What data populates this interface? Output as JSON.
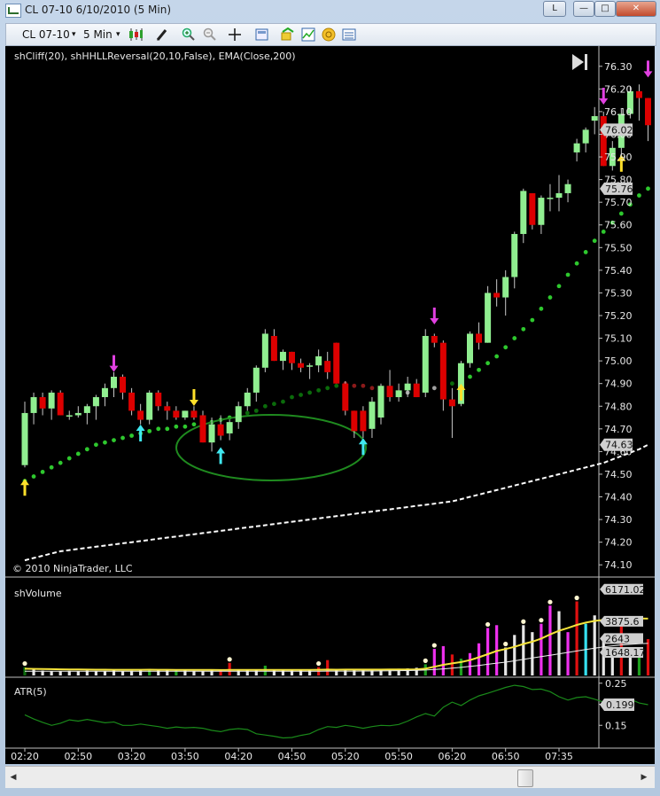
{
  "window": {
    "title": "CL 07-10  6/10/2010 (5 Min)",
    "btn_l": "L",
    "btn_min": "—",
    "btn_max": "□",
    "btn_close": "✕"
  },
  "toolbar": {
    "instrument": "CL 07-10",
    "interval": "5 Min",
    "dropdown_glyph": "▾",
    "icons": [
      "candlestick-style-icon",
      "pencil-draw-icon",
      "zoom-in-icon",
      "zoom-out-icon",
      "crosshair-icon",
      "properties-icon",
      "strategy-icon",
      "indicator-icon",
      "coin-icon",
      "data-box-icon"
    ]
  },
  "colors": {
    "up": "#90ee90",
    "down": "#dc0000",
    "magenta": "#e040e0",
    "cyan": "#40e8f0",
    "yellow": "#ffe02a",
    "green_dot": "#2ec82e",
    "darkgreen_dot": "#0b6b0b",
    "red_dot": "#8b1a1a",
    "gray_dot": "#a0a0a0",
    "ellipse": "#1f8a1f"
  },
  "chart_data": [
    {
      "type": "line",
      "panel": "price",
      "title": "shCliff(20), shHHLLReversal(20,10,False), EMA(Close,200)",
      "copyright": "© 2010 NinjaTrader, LLC",
      "ylim": [
        74.05,
        76.35
      ],
      "yticks": [
        "76.30",
        "76.20",
        "76.10",
        "76.00",
        "75.90",
        "75.80",
        "75.70",
        "75.60",
        "75.50",
        "75.40",
        "75.30",
        "75.20",
        "75.10",
        "75.00",
        "74.90",
        "74.80",
        "74.70",
        "74.60",
        "74.50",
        "74.40",
        "74.30",
        "74.20",
        "74.10"
      ],
      "xticks": [
        "02:20",
        "02:50",
        "03:20",
        "03:50",
        "04:20",
        "04:50",
        "05:20",
        "05:50",
        "06:20",
        "06:50",
        "07:35"
      ],
      "xtick_index": [
        0,
        6,
        12,
        18,
        24,
        30,
        36,
        42,
        48,
        54,
        60
      ],
      "candles": [
        [
          74.54,
          74.82,
          74.53,
          74.77
        ],
        [
          74.77,
          74.86,
          74.72,
          74.84
        ],
        [
          74.84,
          74.86,
          74.76,
          74.79
        ],
        [
          74.79,
          74.87,
          74.74,
          74.86
        ],
        [
          74.86,
          74.87,
          74.76,
          74.76
        ],
        [
          74.76,
          74.78,
          74.74,
          74.76
        ],
        [
          74.76,
          74.8,
          74.75,
          74.77
        ],
        [
          74.77,
          74.81,
          74.72,
          74.8
        ],
        [
          74.8,
          74.85,
          74.74,
          74.84
        ],
        [
          74.84,
          74.9,
          74.8,
          74.88
        ],
        [
          74.88,
          74.95,
          74.84,
          74.93
        ],
        [
          74.93,
          74.94,
          74.83,
          74.86
        ],
        [
          74.86,
          74.88,
          74.76,
          74.78
        ],
        [
          74.78,
          74.81,
          74.72,
          74.74
        ],
        [
          74.74,
          74.87,
          74.72,
          74.86
        ],
        [
          74.86,
          74.87,
          74.78,
          74.8
        ],
        [
          74.8,
          74.82,
          74.74,
          74.78
        ],
        [
          74.78,
          74.8,
          74.74,
          74.75
        ],
        [
          74.75,
          74.78,
          74.74,
          74.78
        ],
        [
          74.78,
          74.8,
          74.74,
          74.75
        ],
        [
          74.76,
          74.78,
          74.64,
          74.64
        ],
        [
          74.64,
          74.75,
          74.6,
          74.72
        ],
        [
          74.72,
          74.76,
          74.65,
          74.67
        ],
        [
          74.68,
          74.74,
          74.65,
          74.73
        ],
        [
          74.73,
          74.82,
          74.7,
          74.8
        ],
        [
          74.8,
          74.88,
          74.78,
          74.86
        ],
        [
          74.86,
          74.98,
          74.82,
          74.97
        ],
        [
          74.97,
          75.14,
          74.95,
          75.12
        ],
        [
          75.11,
          75.14,
          75.0,
          75.0
        ],
        [
          75.0,
          75.05,
          74.96,
          75.04
        ],
        [
          75.04,
          75.04,
          74.96,
          74.99
        ],
        [
          74.99,
          75.01,
          74.95,
          74.97
        ],
        [
          74.98,
          74.99,
          74.92,
          74.98
        ],
        [
          74.98,
          75.05,
          74.95,
          75.02
        ],
        [
          75.0,
          75.04,
          74.92,
          74.95
        ],
        [
          75.08,
          75.08,
          74.9,
          74.9
        ],
        [
          74.9,
          74.91,
          74.76,
          74.78
        ],
        [
          74.78,
          74.78,
          74.66,
          74.69
        ],
        [
          74.78,
          74.8,
          74.66,
          74.69
        ],
        [
          74.7,
          74.84,
          74.66,
          74.82
        ],
        [
          74.75,
          74.9,
          74.72,
          74.89
        ],
        [
          74.89,
          74.96,
          74.82,
          74.84
        ],
        [
          74.84,
          74.9,
          74.82,
          74.87
        ],
        [
          74.87,
          74.93,
          74.84,
          74.9
        ],
        [
          74.9,
          74.92,
          74.84,
          74.84
        ],
        [
          74.86,
          75.14,
          74.84,
          75.11
        ],
        [
          75.11,
          75.12,
          75.06,
          75.08
        ],
        [
          75.08,
          75.09,
          74.78,
          74.83
        ],
        [
          74.83,
          74.88,
          74.66,
          74.8
        ],
        [
          74.81,
          75.0,
          74.8,
          74.99
        ],
        [
          74.99,
          75.13,
          74.97,
          75.12
        ],
        [
          75.12,
          75.17,
          75.05,
          75.08
        ],
        [
          75.08,
          75.33,
          75.08,
          75.3
        ],
        [
          75.3,
          75.36,
          75.24,
          75.28
        ],
        [
          75.28,
          75.4,
          75.2,
          75.37
        ],
        [
          75.37,
          75.57,
          75.32,
          75.56
        ],
        [
          75.56,
          75.76,
          75.52,
          75.75
        ],
        [
          75.74,
          75.74,
          75.58,
          75.6
        ],
        [
          75.6,
          75.73,
          75.56,
          75.72
        ],
        [
          75.72,
          75.78,
          75.66,
          75.72
        ],
        [
          75.72,
          75.82,
          75.66,
          75.74
        ],
        [
          75.74,
          75.8,
          75.7,
          75.78
        ],
        [
          75.92,
          75.98,
          75.88,
          75.96
        ],
        [
          75.96,
          76.03,
          75.92,
          76.02
        ],
        [
          76.06,
          76.12,
          76.0,
          76.08
        ],
        [
          76.08,
          76.1,
          75.86,
          75.86
        ],
        [
          75.86,
          75.97,
          75.84,
          75.94
        ],
        [
          75.94,
          76.11,
          75.89,
          76.09
        ],
        [
          76.09,
          76.21,
          76.07,
          76.19
        ],
        [
          76.19,
          76.22,
          76.06,
          76.16
        ],
        [
          76.16,
          76.16,
          75.97,
          76.04
        ]
      ],
      "cliff": [
        74.47,
        74.49,
        74.51,
        74.53,
        74.55,
        74.57,
        74.59,
        74.61,
        74.63,
        74.64,
        74.65,
        74.66,
        74.67,
        74.68,
        74.69,
        74.7,
        74.7,
        74.71,
        74.71,
        74.72,
        74.73,
        74.73,
        74.74,
        74.75,
        74.76,
        74.77,
        74.78,
        74.8,
        74.81,
        74.82,
        74.84,
        74.85,
        74.86,
        74.87,
        74.88,
        74.89,
        74.9,
        74.89,
        74.89,
        74.88,
        74.88,
        74.87,
        74.86,
        74.86,
        74.86,
        74.87,
        74.88,
        74.89,
        74.9,
        74.91,
        74.93,
        74.96,
        74.99,
        75.02,
        75.06,
        75.1,
        75.14,
        75.18,
        75.23,
        75.28,
        75.33,
        75.38,
        75.43,
        75.48,
        75.53,
        75.57,
        75.61,
        75.65,
        75.69,
        75.73,
        75.76
      ],
      "cliff_color": [
        "g",
        "g",
        "g",
        "g",
        "g",
        "g",
        "g",
        "g",
        "g",
        "g",
        "g",
        "g",
        "g",
        "g",
        "g",
        "g",
        "g",
        "g",
        "g",
        "g",
        "g",
        "g",
        "g",
        "g",
        "dg",
        "dg",
        "dg",
        "dg",
        "dg",
        "dg",
        "dg",
        "dg",
        "dg",
        "dg",
        "dg",
        "dg",
        "r",
        "r",
        "r",
        "r",
        "gr",
        "gr",
        "gr",
        "gr",
        "gr",
        "gr",
        "gr",
        "dg",
        "dg",
        "dg",
        "g",
        "g",
        "g",
        "g",
        "g",
        "g",
        "g",
        "g",
        "g",
        "g",
        "g",
        "g",
        "g",
        "g",
        "g",
        "g",
        "g",
        "g",
        "g",
        "g",
        "g"
      ],
      "ema": [
        74.12,
        74.13,
        74.14,
        74.15,
        74.16,
        74.165,
        74.17,
        74.175,
        74.18,
        74.185,
        74.19,
        74.195,
        74.2,
        74.205,
        74.21,
        74.215,
        74.22,
        74.225,
        74.23,
        74.235,
        74.24,
        74.245,
        74.25,
        74.255,
        74.26,
        74.265,
        74.27,
        74.275,
        74.28,
        74.285,
        74.29,
        74.295,
        74.3,
        74.305,
        74.31,
        74.315,
        74.32,
        74.325,
        74.33,
        74.335,
        74.34,
        74.345,
        74.35,
        74.355,
        74.36,
        74.365,
        74.37,
        74.375,
        74.38,
        74.39,
        74.4,
        74.41,
        74.42,
        74.43,
        74.44,
        74.45,
        74.46,
        74.47,
        74.48,
        74.49,
        74.5,
        74.51,
        74.52,
        74.53,
        74.54,
        74.55,
        74.565,
        74.58,
        74.595,
        74.61,
        74.63
      ],
      "arrows": [
        {
          "i": 0,
          "dir": "up",
          "color": "yellow",
          "y": 74.44
        },
        {
          "i": 10,
          "dir": "down",
          "color": "magenta",
          "y": 74.99
        },
        {
          "i": 13,
          "dir": "up",
          "color": "cyan",
          "y": 74.68
        },
        {
          "i": 19,
          "dir": "down",
          "color": "yellow",
          "y": 74.84
        },
        {
          "i": 22,
          "dir": "up",
          "color": "cyan",
          "y": 74.58
        },
        {
          "i": 38,
          "dir": "up",
          "color": "cyan",
          "y": 74.62
        },
        {
          "i": 46,
          "dir": "down",
          "color": "magenta",
          "y": 75.2
        },
        {
          "i": 49,
          "dir": "up",
          "color": "yellow",
          "y": 74.86
        },
        {
          "i": 65,
          "dir": "down",
          "color": "magenta",
          "y": 76.17
        },
        {
          "i": 67,
          "dir": "up",
          "color": "yellow",
          "y": 75.87
        },
        {
          "i": 70,
          "dir": "down",
          "color": "magenta",
          "y": 76.29
        }
      ],
      "last_labels": [
        "76.02",
        "75.76",
        "74.63"
      ]
    },
    {
      "type": "bar",
      "panel": "volume",
      "title": "shVolume",
      "ylim": [
        0,
        6600
      ],
      "last_labels": [
        "6171.02",
        "3875.6",
        "2643",
        "1648.17"
      ],
      "volume": [
        600,
        450,
        350,
        300,
        300,
        330,
        300,
        350,
        300,
        320,
        350,
        300,
        330,
        350,
        450,
        380,
        350,
        400,
        360,
        320,
        300,
        350,
        400,
        900,
        380,
        350,
        400,
        700,
        350,
        380,
        400,
        420,
        380,
        600,
        1100,
        400,
        420,
        380,
        450,
        400,
        420,
        450,
        480,
        500,
        550,
        800,
        1900,
        2100,
        1500,
        1200,
        1600,
        2300,
        3400,
        3600,
        2000,
        2900,
        3600,
        3100,
        3700,
        5000,
        4600,
        3100,
        5300,
        3700,
        4300,
        2500,
        1900,
        3600,
        1800,
        1600,
        2600
      ],
      "vcolor": [
        "dg",
        "w",
        "w",
        "w",
        "w",
        "w",
        "w",
        "w",
        "w",
        "w",
        "w",
        "w",
        "w",
        "w",
        "g",
        "w",
        "w",
        "g",
        "w",
        "w",
        "w",
        "w",
        "r",
        "r",
        "w",
        "w",
        "w",
        "g",
        "w",
        "w",
        "w",
        "w",
        "w",
        "r",
        "r",
        "w",
        "w",
        "w",
        "w",
        "w",
        "w",
        "w",
        "w",
        "w",
        "w",
        "g",
        "m",
        "m",
        "r",
        "g",
        "m",
        "m",
        "m",
        "m",
        "w",
        "w",
        "w",
        "w",
        "m",
        "m",
        "w",
        "m",
        "r",
        "c",
        "w",
        "w",
        "w",
        "r",
        "w",
        "g",
        "r"
      ],
      "white_dots": [
        0,
        23,
        33,
        45,
        46,
        52,
        54,
        56,
        58,
        59,
        62
      ],
      "avg_yellow": [
        480,
        470,
        460,
        450,
        440,
        430,
        425,
        420,
        415,
        410,
        405,
        405,
        405,
        408,
        410,
        408,
        405,
        402,
        400,
        398,
        395,
        392,
        390,
        395,
        400,
        392,
        392,
        400,
        398,
        396,
        395,
        397,
        398,
        405,
        420,
        415,
        418,
        418,
        420,
        420,
        422,
        424,
        428,
        432,
        440,
        480,
        620,
        760,
        860,
        960,
        1100,
        1300,
        1520,
        1750,
        1890,
        2050,
        2250,
        2420,
        2640,
        2940,
        3200,
        3400,
        3620,
        3780,
        3900,
        3980,
        4030,
        4060,
        4080,
        4080,
        4070
      ],
      "avg_white": [
        300,
        300,
        300,
        300,
        300,
        300,
        300,
        300,
        300,
        300,
        300,
        300,
        300,
        300,
        300,
        300,
        300,
        300,
        300,
        300,
        300,
        300,
        300,
        300,
        300,
        300,
        300,
        300,
        300,
        300,
        300,
        300,
        300,
        300,
        310,
        310,
        310,
        310,
        315,
        320,
        325,
        330,
        340,
        350,
        370,
        390,
        430,
        470,
        520,
        580,
        650,
        720,
        800,
        880,
        950,
        1050,
        1150,
        1250,
        1350,
        1450,
        1550,
        1650,
        1750,
        1850,
        1950,
        2050,
        2120,
        2180,
        2230,
        2270,
        2300
      ]
    },
    {
      "type": "line",
      "panel": "atr",
      "title": "ATR(5)",
      "ylim": [
        0.1,
        0.26
      ],
      "yticks": [
        "0.25",
        "0.2",
        "0.15"
      ],
      "last_label": "0.199",
      "atr": [
        0.175,
        0.165,
        0.157,
        0.15,
        0.155,
        0.163,
        0.16,
        0.164,
        0.16,
        0.156,
        0.158,
        0.15,
        0.15,
        0.153,
        0.15,
        0.147,
        0.143,
        0.146,
        0.144,
        0.145,
        0.143,
        0.138,
        0.135,
        0.14,
        0.142,
        0.14,
        0.13,
        0.127,
        0.124,
        0.12,
        0.121,
        0.126,
        0.13,
        0.14,
        0.147,
        0.145,
        0.15,
        0.147,
        0.143,
        0.147,
        0.15,
        0.149,
        0.152,
        0.16,
        0.17,
        0.178,
        0.172,
        0.193,
        0.205,
        0.197,
        0.21,
        0.22,
        0.226,
        0.233,
        0.24,
        0.245,
        0.242,
        0.235,
        0.236,
        0.23,
        0.218,
        0.21,
        0.216,
        0.218,
        0.212,
        0.205,
        0.198,
        0.206,
        0.212,
        0.203,
        0.199
      ]
    }
  ]
}
